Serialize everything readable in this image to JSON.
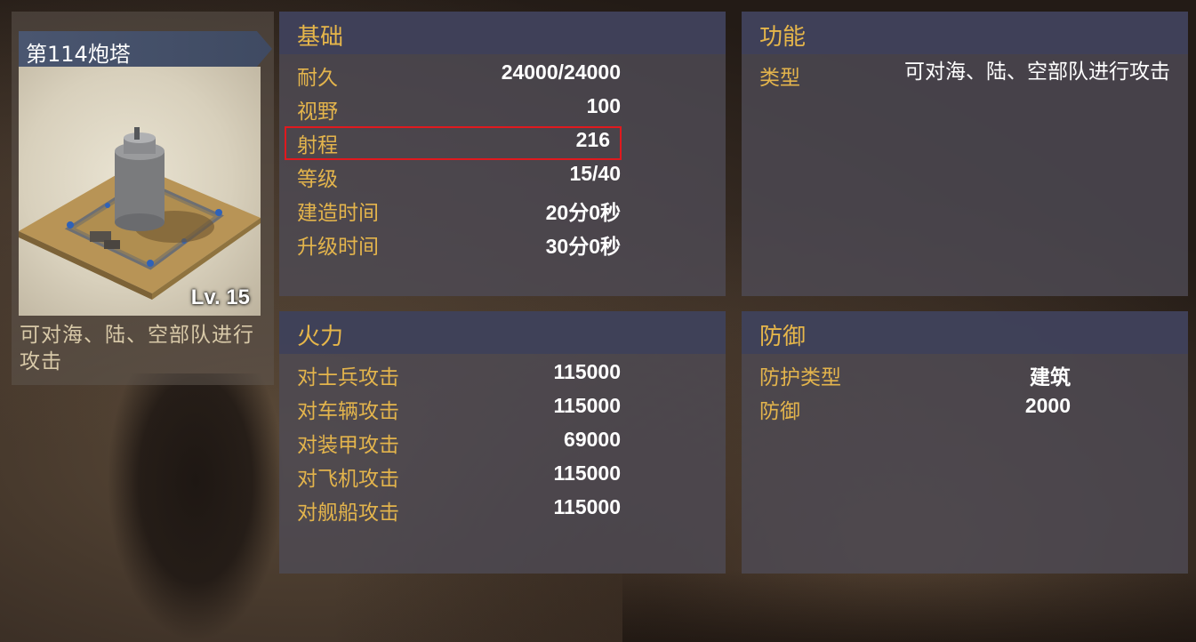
{
  "building": {
    "name": "第114炮塔",
    "level_label": "Lv. 15",
    "description": "可对海、陆、空部队进行攻击"
  },
  "sections": {
    "basic": {
      "title": "基础",
      "rows": [
        {
          "label": "耐久",
          "value": "24000/24000"
        },
        {
          "label": "视野",
          "value": "100"
        },
        {
          "label": "射程",
          "value": "216"
        },
        {
          "label": "等级",
          "value": "15/40"
        },
        {
          "label": "建造时间",
          "value": "20分0秒"
        },
        {
          "label": "升级时间",
          "value": "30分0秒"
        }
      ]
    },
    "function": {
      "title": "功能",
      "rows": [
        {
          "label": "类型",
          "value": "可对海、陆、空部队进行攻击"
        }
      ]
    },
    "firepower": {
      "title": "火力",
      "rows": [
        {
          "label": "对士兵攻击",
          "value": "115000"
        },
        {
          "label": "对车辆攻击",
          "value": "115000"
        },
        {
          "label": "对装甲攻击",
          "value": "69000"
        },
        {
          "label": "对飞机攻击",
          "value": "115000"
        },
        {
          "label": "对舰船攻击",
          "value": "115000"
        }
      ]
    },
    "defense": {
      "title": "防御",
      "rows": [
        {
          "label": "防护类型",
          "value": "建筑"
        },
        {
          "label": "防御",
          "value": "2000"
        }
      ]
    }
  },
  "highlighted_row": "射程",
  "colors": {
    "label_gold": "#e3b44c",
    "value_white": "#ffffff",
    "highlight_red": "#e0191e",
    "panel_header": "#3e405a"
  }
}
